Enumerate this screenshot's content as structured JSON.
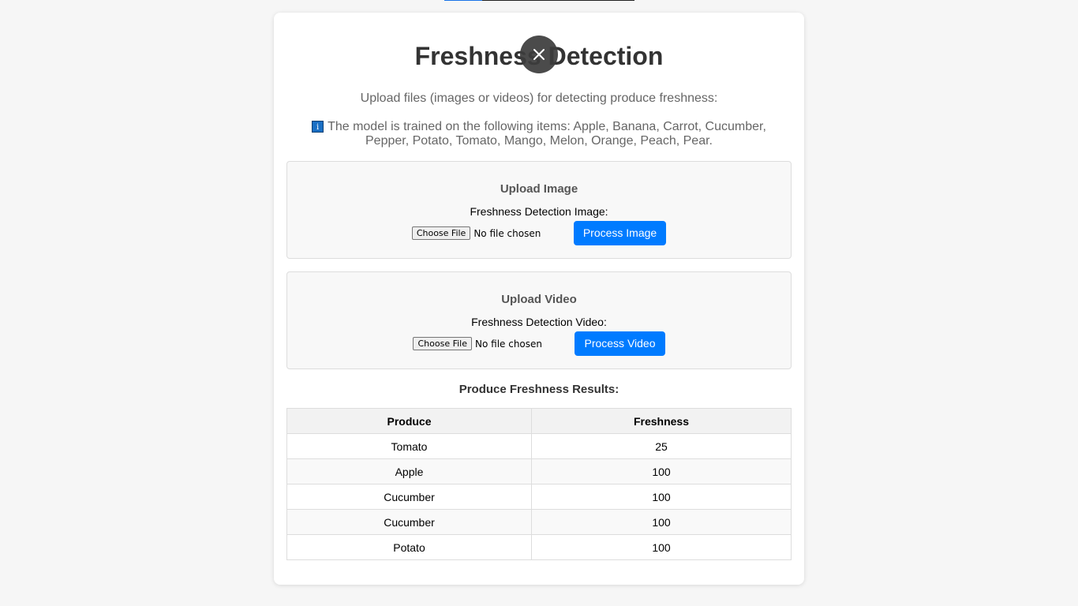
{
  "page": {
    "title": "Freshness Detection",
    "subtitle": "Upload files (images or videos) for detecting produce freshness:",
    "info_icon": "info-icon",
    "info_text": "The model is trained on the following items: Apple, Banana, Carrot, Cucumber, Pepper, Potato, Tomato, Mango, Melon, Orange, Peach, Pear."
  },
  "overlay": {
    "close_symbol": "✕",
    "icon": "close-icon"
  },
  "upload_image": {
    "heading": "Upload Image",
    "label": "Freshness Detection Image:",
    "choose_button": "Choose File",
    "file_status": "No file chosen",
    "process_button": "Process Image"
  },
  "upload_video": {
    "heading": "Upload Video",
    "label": "Freshness Detection Video:",
    "choose_button": "Choose File",
    "file_status": "No file chosen",
    "process_button": "Process Video"
  },
  "results": {
    "title": "Produce Freshness Results:",
    "columns": [
      "Produce",
      "Freshness"
    ],
    "rows": [
      [
        "Tomato",
        "25"
      ],
      [
        "Apple",
        "100"
      ],
      [
        "Cucumber",
        "100"
      ],
      [
        "Cucumber",
        "100"
      ],
      [
        "Potato",
        "100"
      ]
    ]
  },
  "colors": {
    "primary_button": "#007bff",
    "page_background": "#f6f6f6",
    "card_background": "#ffffff"
  }
}
